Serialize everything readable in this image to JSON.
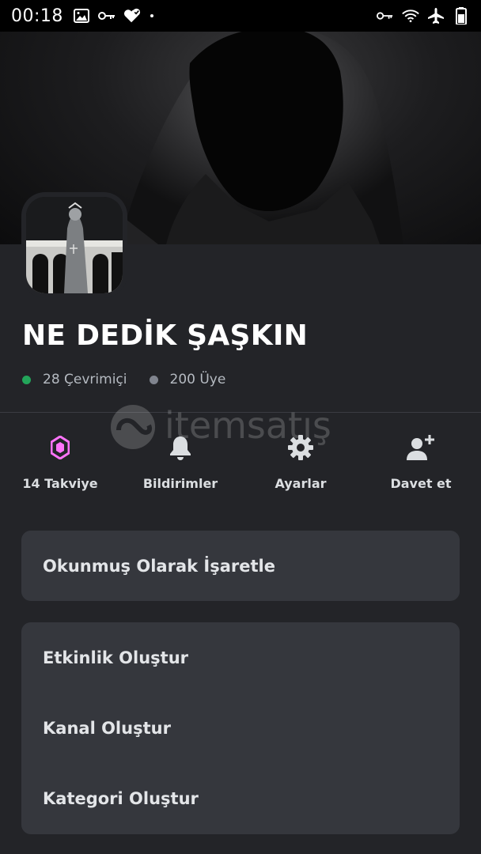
{
  "status_bar": {
    "time": "00:18",
    "left_icons": [
      "image-icon",
      "key-icon",
      "heart-check-icon"
    ],
    "right_icons": [
      "key-icon",
      "wifi-icon",
      "airplane-icon",
      "battery-icon"
    ]
  },
  "server": {
    "name": "NE DEDİK ŞAŞKIN",
    "online_label": "28 Çevrimiçi",
    "members_label": "200 Üye"
  },
  "watermark": {
    "text": "itemsatış"
  },
  "actions": [
    {
      "id": "boost",
      "label": "14 Takviye",
      "icon": "boost-gem-icon",
      "color": "#ff73fa"
    },
    {
      "id": "notifications",
      "label": "Bildirimler",
      "icon": "bell-icon",
      "color": "#dbdee1"
    },
    {
      "id": "settings",
      "label": "Ayarlar",
      "icon": "gear-icon",
      "color": "#dbdee1"
    },
    {
      "id": "invite",
      "label": "Davet et",
      "icon": "add-user-icon",
      "color": "#dbdee1"
    }
  ],
  "menu": {
    "mark_read": "Okunmuş Olarak İşaretle",
    "create_event": "Etkinlik Oluştur",
    "create_channel": "Kanal Oluştur",
    "create_category": "Kategori Oluştur"
  },
  "colors": {
    "background": "#232428",
    "card": "#35373d",
    "online": "#23a55a",
    "offline": "#80848e",
    "boost": "#ff73fa"
  }
}
